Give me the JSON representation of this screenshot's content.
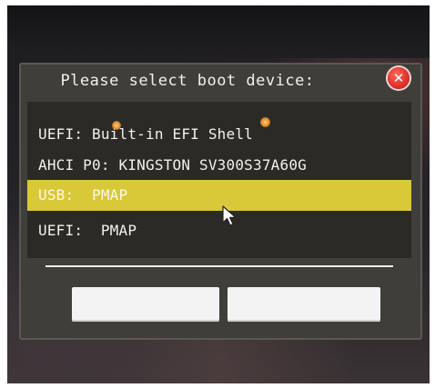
{
  "dialog": {
    "title": "Please select boot device:",
    "close_icon": "close-icon",
    "close_color": "#e0302a",
    "selection_color": "#d9c838"
  },
  "devices": [
    {
      "label": "UEFI: Built-in EFI Shell",
      "selected": false
    },
    {
      "label": "AHCI P0: KINGSTON SV300S37A60G",
      "selected": false
    },
    {
      "label": "USB:  PMAP",
      "selected": true
    },
    {
      "label": "UEFI:  PMAP",
      "selected": false
    }
  ],
  "buttons": {
    "left_label": "",
    "right_label": ""
  },
  "cursor_icon": "mouse-pointer-icon"
}
